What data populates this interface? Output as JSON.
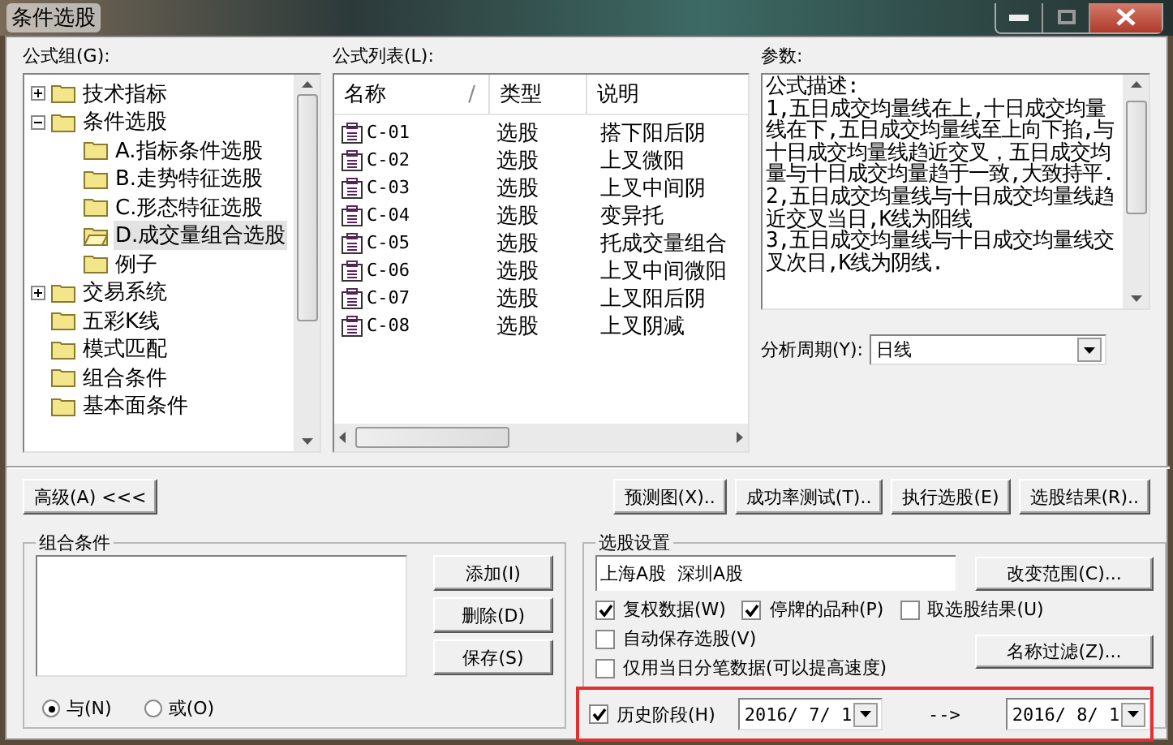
{
  "window": {
    "title": "条件选股"
  },
  "formula_groups": {
    "label": "公式组(G):",
    "items": [
      {
        "label": "技术指标",
        "expanded": false,
        "selected": false
      },
      {
        "label": "条件选股",
        "expanded": true,
        "selected": false,
        "children": [
          {
            "label": "A.指标条件选股",
            "selected": false
          },
          {
            "label": "B.走势特征选股",
            "selected": false
          },
          {
            "label": "C.形态特征选股",
            "selected": false
          },
          {
            "label": "D.成交量组合选股",
            "selected": true
          },
          {
            "label": "例子",
            "selected": false
          }
        ]
      },
      {
        "label": "交易系统",
        "expanded": false,
        "selected": false
      },
      {
        "label": "五彩K线",
        "selected": false
      },
      {
        "label": "模式匹配",
        "selected": false
      },
      {
        "label": "组合条件",
        "selected": false
      },
      {
        "label": "基本面条件",
        "selected": false
      }
    ]
  },
  "formula_list": {
    "label": "公式列表(L):",
    "columns": [
      "名称",
      "类型",
      "说明"
    ],
    "sort_mark": "/",
    "rows": [
      {
        "name": "C-01",
        "type": "选股",
        "description": "搭下阳后阴"
      },
      {
        "name": "C-02",
        "type": "选股",
        "description": "上叉微阳"
      },
      {
        "name": "C-03",
        "type": "选股",
        "description": "上叉中间阴"
      },
      {
        "name": "C-04",
        "type": "选股",
        "description": "变异托"
      },
      {
        "name": "C-05",
        "type": "选股",
        "description": "托成交量组合"
      },
      {
        "name": "C-06",
        "type": "选股",
        "description": "上叉中间微阳"
      },
      {
        "name": "C-07",
        "type": "选股",
        "description": "上叉阳后阴"
      },
      {
        "name": "C-08",
        "type": "选股",
        "description": "上叉阴减"
      }
    ]
  },
  "parameters": {
    "label": "参数:",
    "text": "公式描述:\n1,五日成交均量线在上,十日成交均量线在下,五日成交均量线至上向下掐,与十日成交均量线趋近交叉，五日成交均量与十日成交均量趋于一致,大致持平.\n2,五日成交均量线与十日成交均量线趋近交叉当日,K线为阳线\n3,五日成交均量线与十日成交均量线交叉次日,K线为阴线.",
    "period_label": "分析周期(Y):",
    "period_value": "日线"
  },
  "advanced_button": "高级(A) <<<",
  "action_buttons": [
    "预测图(X)..",
    "成功率测试(T)..",
    "执行选股(E)",
    "选股结果(R).."
  ],
  "combination": {
    "title": "组合条件",
    "buttons": [
      "添加(I)",
      "删除(D)",
      "保存(S)"
    ],
    "radios": [
      {
        "label": "与(N)",
        "selected": true
      },
      {
        "label": "或(O)",
        "selected": false
      }
    ]
  },
  "settings": {
    "title": "选股设置",
    "range": "上海A股  深圳A股",
    "range_button": "改变范围(C)...",
    "filter_button": "名称过滤(Z)...",
    "options": [
      {
        "label": "复权数据(W)",
        "checked": true
      },
      {
        "label": "停牌的品种(P)",
        "checked": true
      },
      {
        "label": "取选股结果(U)",
        "checked": false
      },
      {
        "label": "自动保存选股(V)",
        "checked": false
      },
      {
        "label": "仅用当日分笔数据(可以提高速度)",
        "checked": false
      }
    ],
    "history": {
      "label": "历史阶段(H)",
      "checked": true,
      "start": "2016/ 7/ 1",
      "arrow": "-->",
      "end": "2016/ 8/ 1"
    }
  }
}
